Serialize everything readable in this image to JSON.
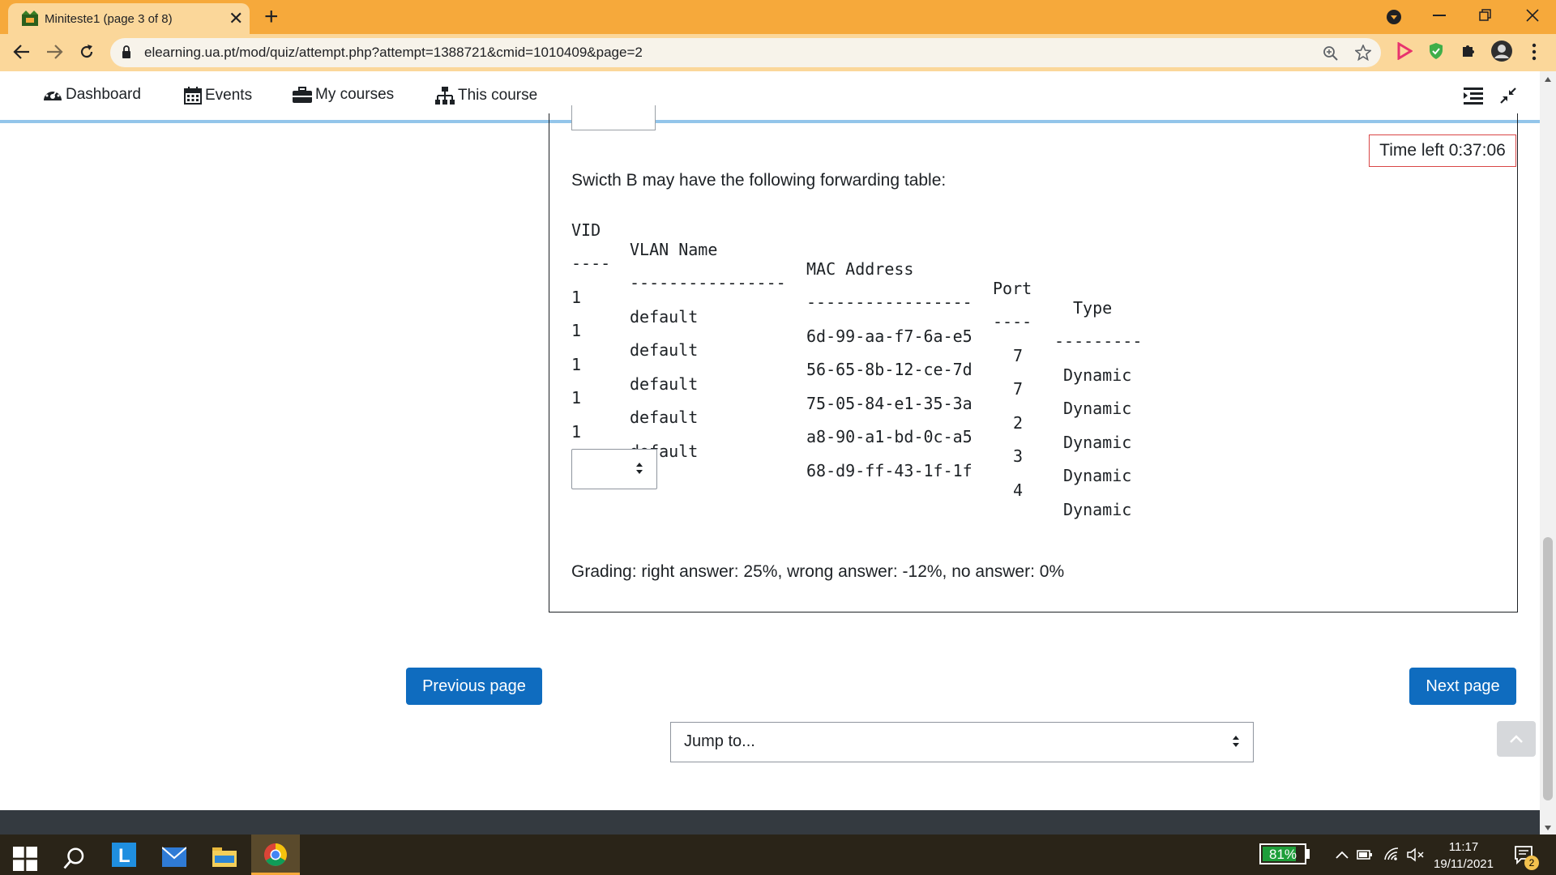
{
  "browser": {
    "tab_title": "Miniteste1 (page 3 of 8)",
    "tab_close": "✕",
    "new_tab": "+",
    "url": "elearning.ua.pt/mod/quiz/attempt.php?attempt=1388721&cmid=1010409&page=2"
  },
  "navbar": {
    "dashboard": "Dashboard",
    "events": "Events",
    "my_courses": "My courses",
    "this_course": "This course"
  },
  "quiz": {
    "timer": "Time left 0:37:06",
    "intro": "Swicth B may have the following forwarding table:",
    "table_headers": [
      "VID",
      "VLAN Name",
      "MAC Address",
      "Port",
      "Type"
    ],
    "table_separators": [
      "----",
      "----------------",
      "-----------------",
      "----",
      "---------"
    ],
    "rows": [
      {
        "vid": "1",
        "vlan": "default",
        "mac": "6d-99-aa-f7-6a-e5",
        "port": "7",
        "type": "Dynamic"
      },
      {
        "vid": "1",
        "vlan": "default",
        "mac": "56-65-8b-12-ce-7d",
        "port": "7",
        "type": "Dynamic"
      },
      {
        "vid": "1",
        "vlan": "default",
        "mac": "75-05-84-e1-35-3a",
        "port": "2",
        "type": "Dynamic"
      },
      {
        "vid": "1",
        "vlan": "default",
        "mac": "a8-90-a1-bd-0c-a5",
        "port": "3",
        "type": "Dynamic"
      },
      {
        "vid": "1",
        "vlan": "default",
        "mac": "68-d9-ff-43-1f-1f",
        "port": "4",
        "type": "Dynamic"
      }
    ],
    "answer_value": "",
    "grading": "Grading: right answer: 25%, wrong answer: -12%, no answer: 0%"
  },
  "navigation": {
    "previous": "Previous page",
    "next": "Next page",
    "jump": "Jump to..."
  },
  "taskbar": {
    "battery": "81%",
    "battery_level": 0.81,
    "time": "11:17",
    "date": "19/11/2021",
    "notifications": "2"
  },
  "colors": {
    "chrome_frame": "#f6a93b",
    "primary_button": "#0f6cbf",
    "timer_border": "#d94646"
  }
}
